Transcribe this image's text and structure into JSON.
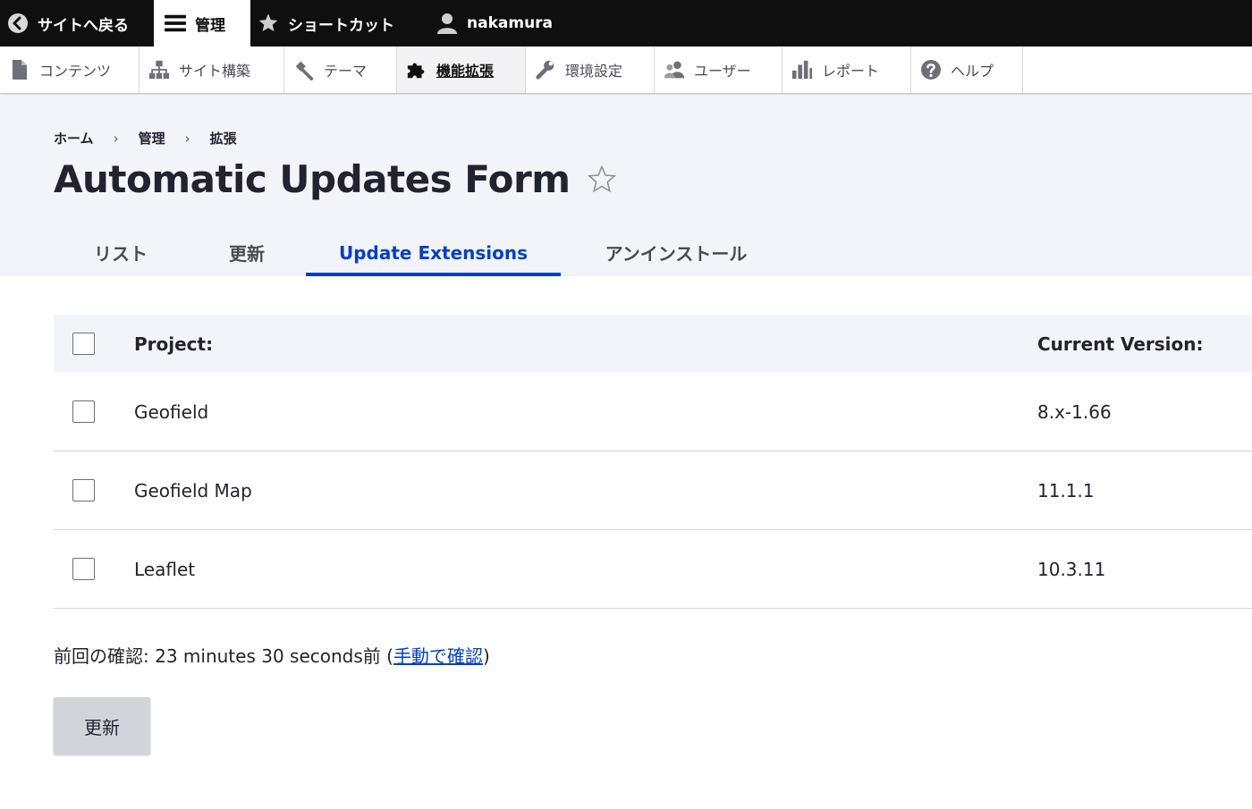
{
  "toolbar": {
    "back_label": "サイトへ戻る",
    "manage_label": "管理",
    "shortcuts_label": "ショートカット",
    "user_label": "nakamura"
  },
  "tray": {
    "items": [
      {
        "label": "コンテンツ",
        "icon": "file-icon"
      },
      {
        "label": "サイト構築",
        "icon": "sitemap-icon"
      },
      {
        "label": "テーマ",
        "icon": "paintbrush-icon"
      },
      {
        "label": "機能拡張",
        "icon": "puzzle-icon",
        "active": true
      },
      {
        "label": "環境設定",
        "icon": "wrench-icon"
      },
      {
        "label": "ユーザー",
        "icon": "people-icon"
      },
      {
        "label": "レポート",
        "icon": "bar-chart-icon"
      },
      {
        "label": "ヘルプ",
        "icon": "help-icon"
      }
    ]
  },
  "breadcrumb": [
    "ホーム",
    "管理",
    "拡張"
  ],
  "breadcrumb_separator": "›",
  "page": {
    "title": "Automatic Updates Form"
  },
  "tabs": [
    {
      "label": "リスト"
    },
    {
      "label": "更新"
    },
    {
      "label": "Update Extensions",
      "active": true
    },
    {
      "label": "アンインストール"
    }
  ],
  "table": {
    "headers": {
      "project": "Project:",
      "version": "Current Version:"
    },
    "rows": [
      {
        "project": "Geofield",
        "version": "8.x-1.66"
      },
      {
        "project": "Geofield Map",
        "version": "11.1.1"
      },
      {
        "project": "Leaflet",
        "version": "10.3.11"
      }
    ]
  },
  "last_check": {
    "prefix": "前回の確認: 23 minutes 30 seconds前 (",
    "link": "手動で確認",
    "suffix": ")"
  },
  "update_button": "更新",
  "colors": {
    "accent": "#003ecc",
    "toolbar_bg": "#0f0f0f",
    "header_bg": "#f3f4f9",
    "button_bg": "#d3d4d9"
  }
}
